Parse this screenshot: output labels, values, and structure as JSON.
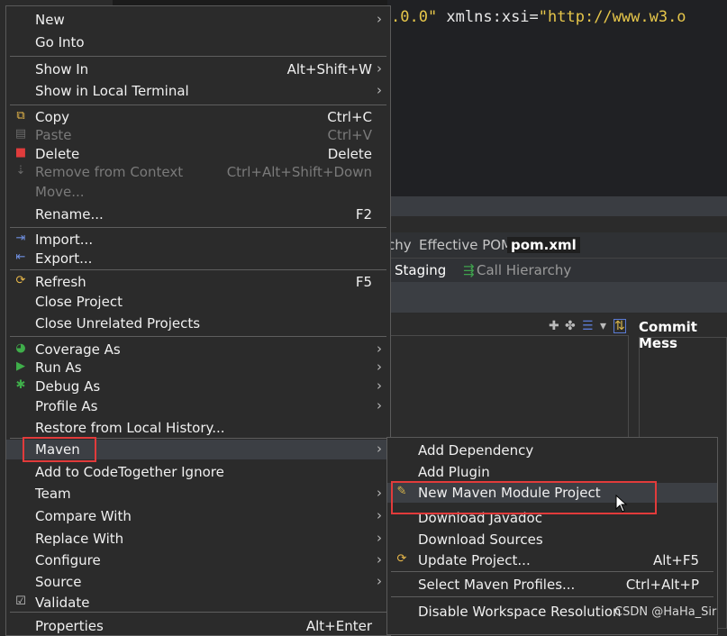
{
  "background": {
    "editor_code_prefix": ".0.0\" ",
    "editor_code_attr": "xmlns:xsi=",
    "editor_code_value": "\"http://www.w3.o",
    "tabs": [
      "chy",
      "Effective POM",
      "pom.xml"
    ],
    "tabs2": [
      "Staging",
      "Call Hierarchy"
    ],
    "commit_title": "Commit Mess"
  },
  "menu": {
    "items": [
      {
        "label": "New",
        "submenu": true
      },
      {
        "label": "Go Into"
      },
      {
        "label": "Show In",
        "accel": "Alt+Shift+W",
        "submenu": true
      },
      {
        "label": "Show in Local Terminal",
        "submenu": true
      },
      {
        "label": "Copy",
        "accel": "Ctrl+C",
        "icon": "copy-icon"
      },
      {
        "label": "Paste",
        "accel": "Ctrl+V",
        "icon": "paste-icon",
        "disabled": true
      },
      {
        "label": "Delete",
        "accel": "Delete",
        "icon": "delete-icon"
      },
      {
        "label": "Remove from Context",
        "accel": "Ctrl+Alt+Shift+Down",
        "icon": "remove-context-icon",
        "disabled": true
      },
      {
        "label": "Move...",
        "disabled": true
      },
      {
        "label": "Rename...",
        "accel": "F2"
      },
      {
        "label": "Import...",
        "icon": "import-icon"
      },
      {
        "label": "Export...",
        "icon": "export-icon"
      },
      {
        "label": "Refresh",
        "accel": "F5",
        "icon": "refresh-icon"
      },
      {
        "label": "Close Project"
      },
      {
        "label": "Close Unrelated Projects"
      },
      {
        "label": "Coverage As",
        "submenu": true,
        "icon": "coverage-icon"
      },
      {
        "label": "Run As",
        "submenu": true,
        "icon": "run-icon"
      },
      {
        "label": "Debug As",
        "submenu": true,
        "icon": "debug-icon"
      },
      {
        "label": "Profile As",
        "submenu": true
      },
      {
        "label": "Restore from Local History..."
      },
      {
        "label": "Maven",
        "submenu": true,
        "highlighted": true
      },
      {
        "label": "Add to CodeTogether Ignore"
      },
      {
        "label": "Team",
        "submenu": true
      },
      {
        "label": "Compare With",
        "submenu": true
      },
      {
        "label": "Replace With",
        "submenu": true
      },
      {
        "label": "Configure",
        "submenu": true
      },
      {
        "label": "Source",
        "submenu": true
      },
      {
        "label": "Validate",
        "icon": "validate-icon"
      },
      {
        "label": "Properties",
        "accel": "Alt+Enter"
      }
    ]
  },
  "submenu": {
    "items": [
      {
        "label": "Add Dependency"
      },
      {
        "label": "Add Plugin"
      },
      {
        "label": "New Maven Module Project",
        "icon": "maven-module-icon",
        "highlighted": true
      },
      {
        "label": "Download Javadoc"
      },
      {
        "label": "Download Sources"
      },
      {
        "label": "Update Project...",
        "accel": "Alt+F5",
        "icon": "update-project-icon"
      },
      {
        "label": "Select Maven Profiles...",
        "accel": "Ctrl+Alt+P"
      },
      {
        "label": "Disable Workspace Resolution"
      }
    ]
  },
  "watermark": "CSDN @HaHa_Sir",
  "colors": {
    "highlight_box": "#e23b3b",
    "menu_bg": "#2b2b2b",
    "string": "#e6c64a"
  }
}
